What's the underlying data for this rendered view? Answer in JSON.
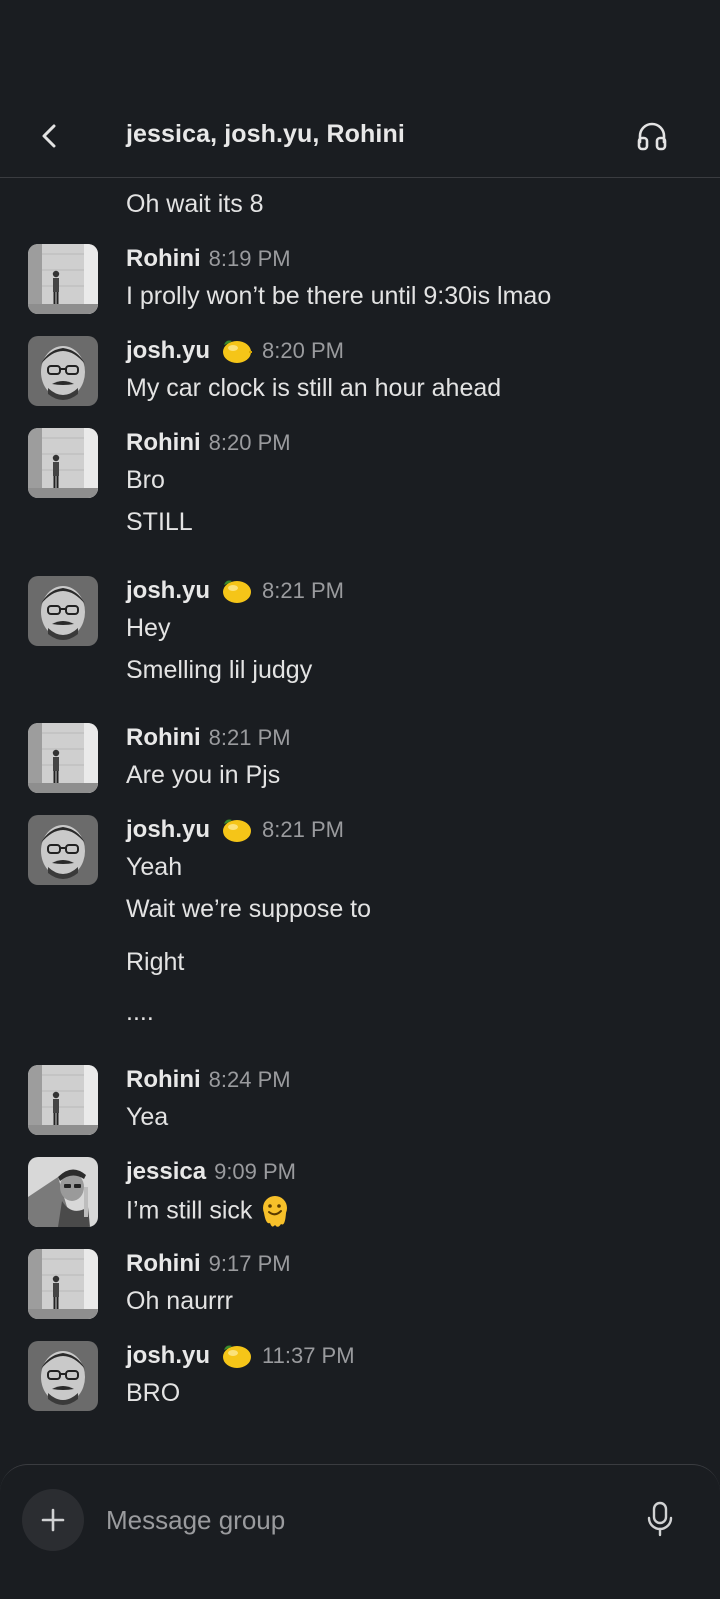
{
  "header": {
    "title": "jessica, josh.yu, Rohini",
    "back_icon": "chevron-left-icon",
    "huddle_icon": "headphones-icon"
  },
  "messages": [
    {
      "type": "continuation",
      "text": "Oh wait its 8"
    },
    {
      "type": "full",
      "author": "Rohini",
      "time": "8:19 PM",
      "avatar": "rohini",
      "text": "I prolly won’t be there until 9:30is lmao"
    },
    {
      "type": "full",
      "author": "josh.yu",
      "time": "8:20 PM",
      "avatar": "josh",
      "status_emoji": "lemon",
      "text": "My car clock is still an hour ahead"
    },
    {
      "type": "full",
      "author": "Rohini",
      "time": "8:20 PM",
      "avatar": "rohini",
      "text": "Bro"
    },
    {
      "type": "continuation",
      "text": "STILL"
    },
    {
      "type": "full",
      "author": "josh.yu",
      "time": "8:21 PM",
      "avatar": "josh",
      "status_emoji": "lemon",
      "text": "Hey"
    },
    {
      "type": "continuation",
      "text": "Smelling lil judgy"
    },
    {
      "type": "full",
      "author": "Rohini",
      "time": "8:21 PM",
      "avatar": "rohini",
      "text": "Are you in Pjs"
    },
    {
      "type": "full",
      "author": "josh.yu",
      "time": "8:21 PM",
      "avatar": "josh",
      "status_emoji": "lemon",
      "text": "Yeah"
    },
    {
      "type": "continuation",
      "text": "Wait we’re suppose to"
    },
    {
      "type": "continuation",
      "text": "Right"
    },
    {
      "type": "continuation",
      "text": "...."
    },
    {
      "type": "full",
      "author": "Rohini",
      "time": "8:24 PM",
      "avatar": "rohini",
      "text": "Yea"
    },
    {
      "type": "full",
      "author": "jessica",
      "time": "9:09 PM",
      "avatar": "jessica",
      "text": "I’m still sick",
      "trailing_emoji": "melting-face"
    },
    {
      "type": "full",
      "author": "Rohini",
      "time": "9:17 PM",
      "avatar": "rohini",
      "text": "Oh naurrr"
    },
    {
      "type": "full",
      "author": "josh.yu",
      "time": "11:37 PM",
      "avatar": "josh",
      "status_emoji": "lemon",
      "text": "BRO"
    }
  ],
  "composer": {
    "placeholder": "Message group",
    "plus_icon": "plus-icon",
    "mic_icon": "microphone-icon"
  },
  "colors": {
    "background": "#1a1d21",
    "text": "#e3e3e3",
    "muted": "#9a9b9e",
    "divider": "#3a3c40"
  }
}
